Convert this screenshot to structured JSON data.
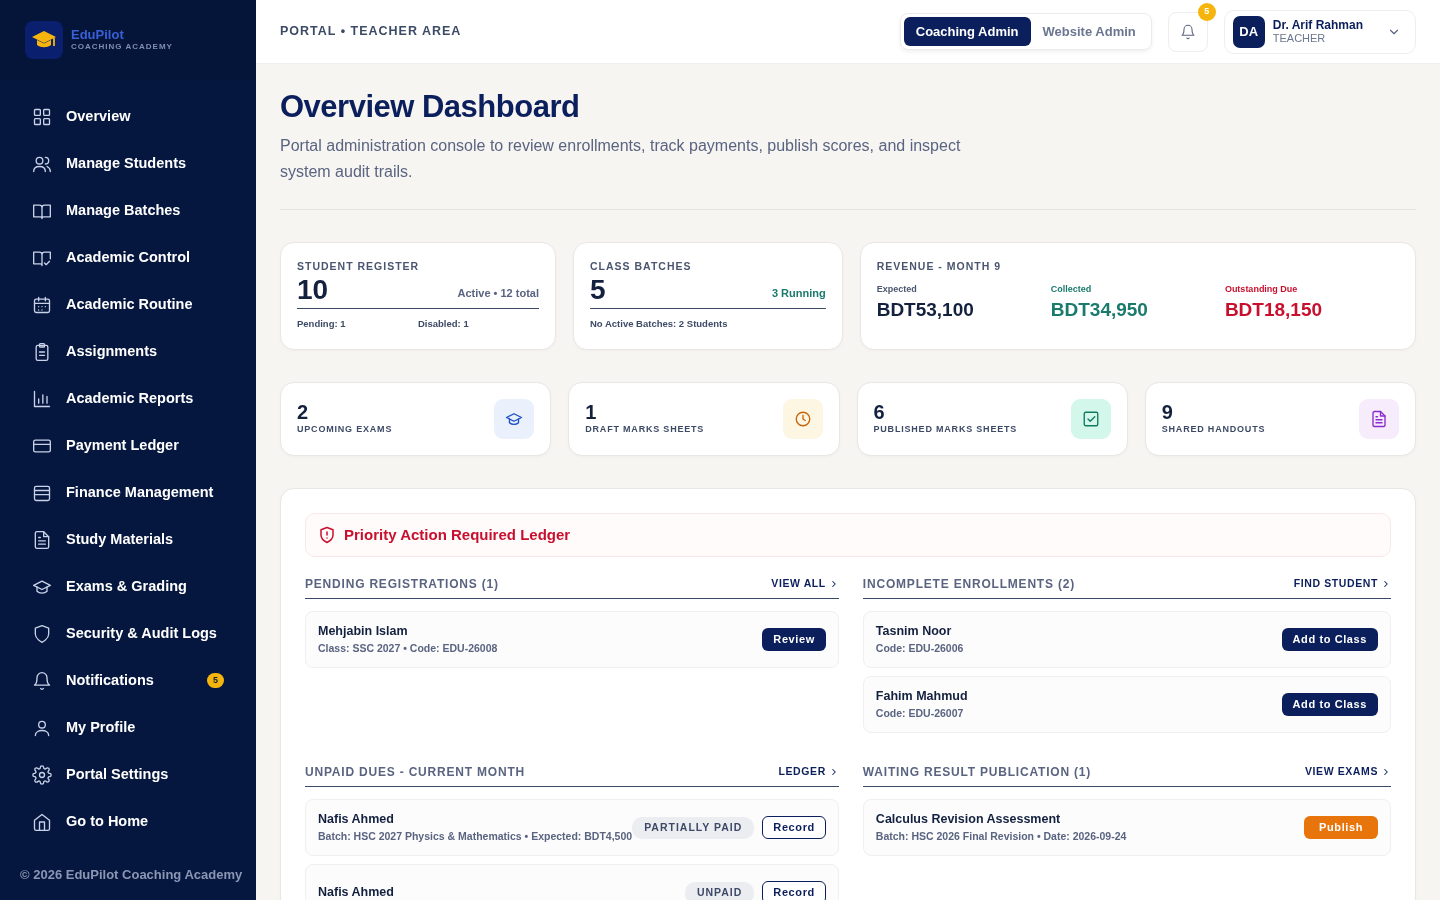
{
  "brand": {
    "name": "EduPilot",
    "tagline": "COACHING ACADEMY"
  },
  "sidebar": {
    "items": [
      {
        "label": "Overview",
        "selected": false
      },
      {
        "label": "Manage Students",
        "selected": false
      },
      {
        "label": "Manage Batches",
        "selected": false
      },
      {
        "label": "Academic Control",
        "selected": false
      },
      {
        "label": "Academic Routine",
        "selected": false
      },
      {
        "label": "Assignments",
        "selected": false
      },
      {
        "label": "Academic Reports",
        "selected": false
      },
      {
        "label": "Payment Ledger",
        "selected": false
      },
      {
        "label": "Finance Management",
        "selected": false
      },
      {
        "label": "Study Materials",
        "selected": false
      },
      {
        "label": "Exams & Grading",
        "selected": false
      },
      {
        "label": "Security & Audit Logs",
        "selected": false
      },
      {
        "label": "Notifications",
        "selected": false,
        "badge": "5"
      },
      {
        "label": "My Profile",
        "selected": false
      },
      {
        "label": "Portal Settings",
        "selected": false
      },
      {
        "label": "Go to Home",
        "selected": false
      }
    ],
    "footer": "© 2026 EduPilot Coaching Academy"
  },
  "header": {
    "breadcrumb": "PORTAL • TEACHER AREA",
    "admin_tabs": [
      {
        "label": "Coaching Admin",
        "selected": true
      },
      {
        "label": "Website Admin",
        "selected": false
      }
    ],
    "notification_count": "5",
    "user": {
      "initials": "DA",
      "name": "Dr. Arif Rahman",
      "role": "TEACHER"
    }
  },
  "page": {
    "title": "Overview Dashboard",
    "subtitle": "Portal administration console to review enrollments, track payments, publish scores, and inspect system audit trails."
  },
  "summary_cards": [
    {
      "kind": "register",
      "title": "STUDENT REGISTER",
      "value": "10",
      "note": "Active • 12 total",
      "footers": [
        "Pending: 1",
        "Disabled: 1"
      ]
    },
    {
      "kind": "batches",
      "title": "CLASS BATCHES",
      "value": "5",
      "note": "3 Running",
      "footers": [
        "No Active Batches: 2 Students"
      ]
    },
    {
      "kind": "revenue",
      "title": "REVENUE - MONTH 9",
      "items": [
        {
          "kind": "expected",
          "label": "Expected",
          "value": "BDT53,100"
        },
        {
          "kind": "collected",
          "label": "Collected",
          "value": "BDT34,950"
        },
        {
          "kind": "due",
          "label": "Outstanding Due",
          "value": "BDT18,150"
        }
      ]
    }
  ],
  "metric_cards": [
    {
      "value": "2",
      "label": "UPCOMING EXAMS",
      "color": "#eaf1fd"
    },
    {
      "value": "1",
      "label": "DRAFT MARKS SHEETS",
      "color": "#fdf6e3"
    },
    {
      "value": "6",
      "label": "PUBLISHED MARKS SHEETS",
      "color": "#d4f7ec"
    },
    {
      "value": "9",
      "label": "SHARED HANDOUTS",
      "color": "#f6ecfc"
    }
  ],
  "priority": {
    "title": "Priority Action Required Ledger"
  },
  "sections": [
    {
      "title": "PENDING REGISTRATIONS (1)",
      "link": "VIEW ALL",
      "rows": [
        {
          "name": "Mehjabin Islam",
          "detail": "Class: SSC 2027 • Code: EDU-26008",
          "action": {
            "label": "Review",
            "kind": "primary"
          }
        }
      ]
    },
    {
      "title": "INCOMPLETE ENROLLMENTS (2)",
      "link": "FIND STUDENT",
      "rows": [
        {
          "name": "Tasnim Noor",
          "detail": "Code: EDU-26006",
          "action": {
            "label": "Add to Class",
            "kind": "primary"
          }
        },
        {
          "name": "Fahim Mahmud",
          "detail": "Code: EDU-26007",
          "action": {
            "label": "Add to Class",
            "kind": "primary"
          }
        }
      ]
    },
    {
      "title": "UNPAID DUES - CURRENT MONTH",
      "link": "LEDGER",
      "rows": [
        {
          "name": "Nafis Ahmed",
          "detail": "Batch: HSC 2027 Physics & Mathematics • Expected: BDT4,500",
          "status": "PARTIALLY PAID",
          "action": {
            "label": "Record",
            "kind": "outline"
          }
        },
        {
          "name": "Nafis Ahmed",
          "status": "UNPAID",
          "action": {
            "label": "Record",
            "kind": "outline"
          }
        }
      ]
    },
    {
      "title": "WAITING RESULT PUBLICATION (1)",
      "link": "VIEW EXAMS",
      "rows": [
        {
          "name": "Calculus Revision Assessment",
          "detail": "Batch: HSC 2026 Final Revision • Date: 2026-09-24",
          "action": {
            "label": "Publish",
            "kind": "warning"
          }
        }
      ]
    }
  ]
}
